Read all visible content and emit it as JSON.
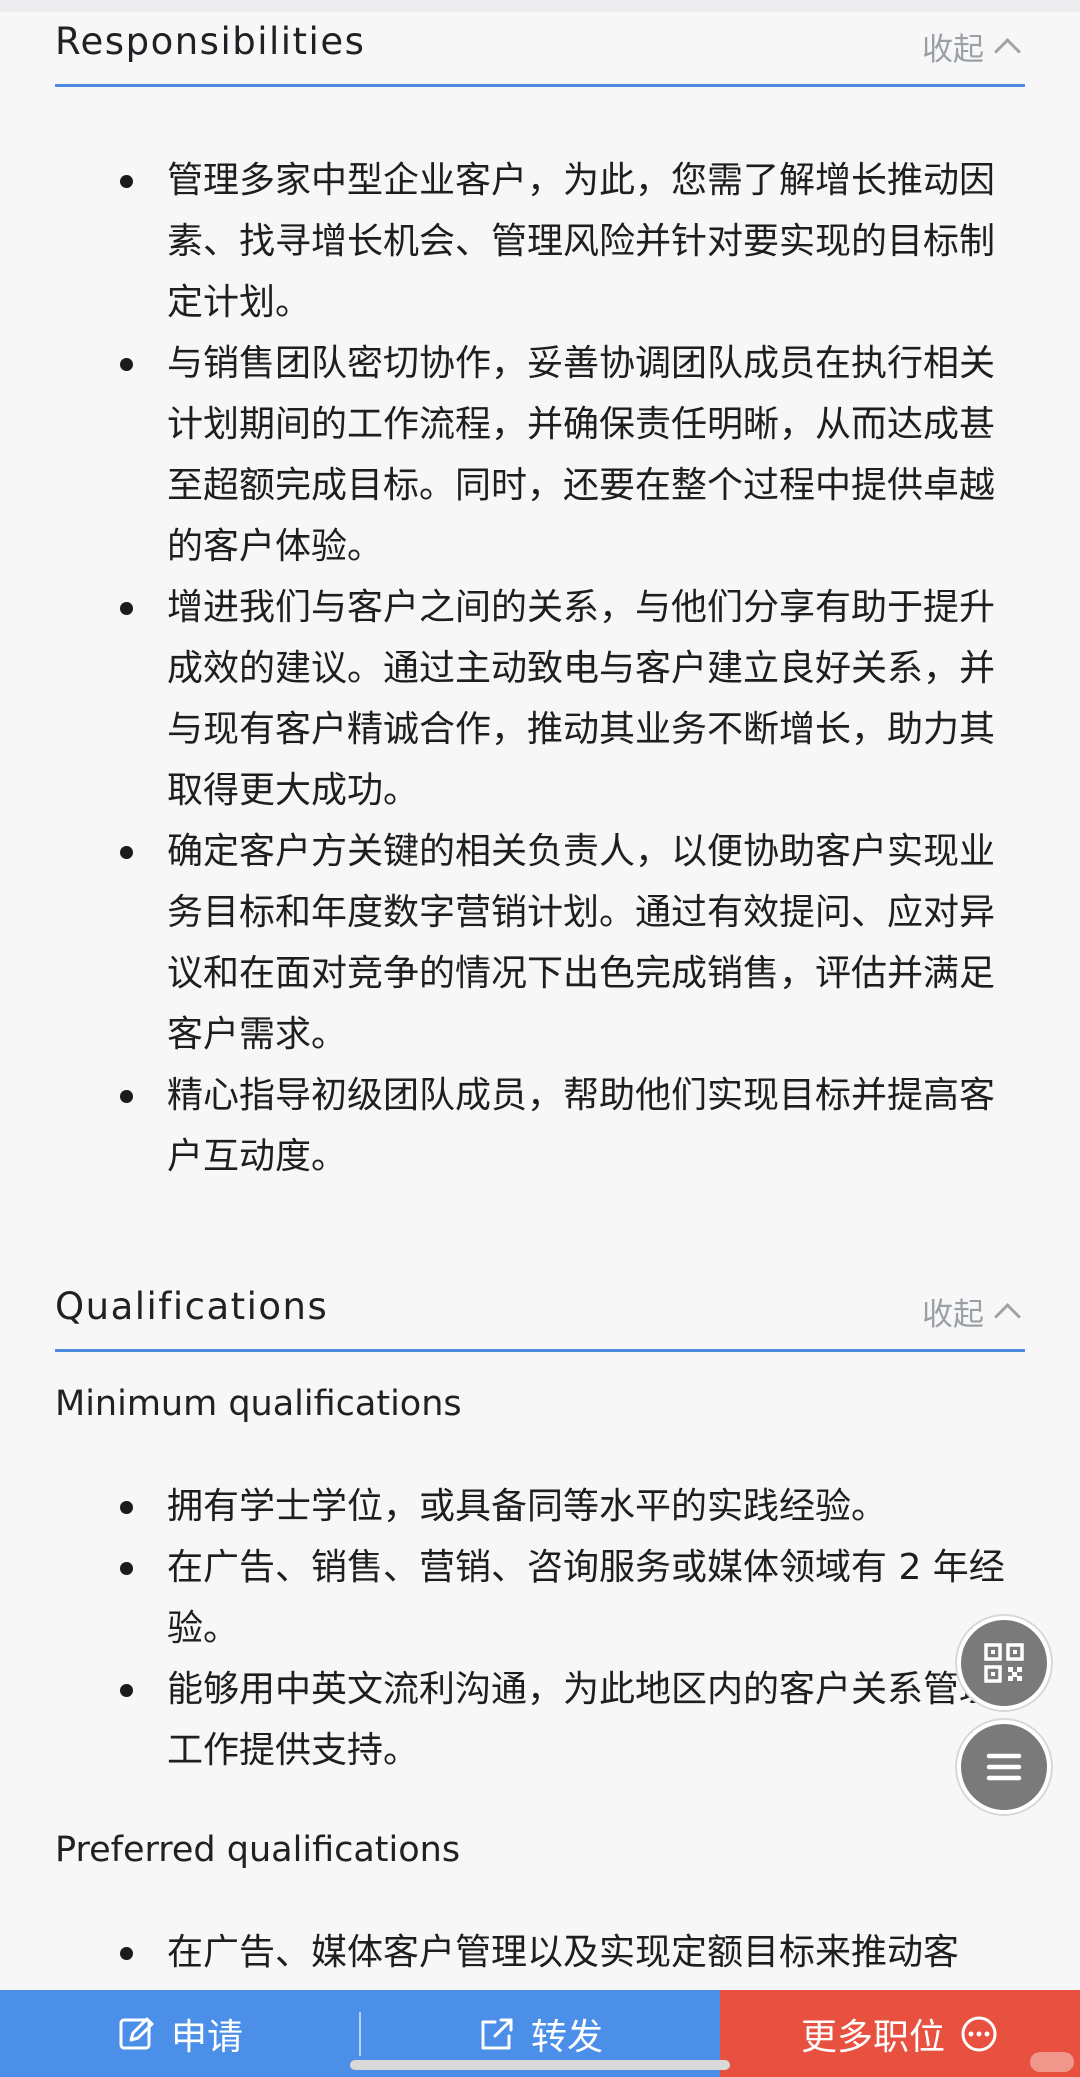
{
  "responsibilities": {
    "title": "Responsibilities",
    "collapse_label": "收起",
    "items": [
      "管理多家中型企业客户，为此，您需了解增长推动因素、找寻增长机会、管理风险并针对要实现的目标制定计划。",
      "与销售团队密切协作，妥善协调团队成员在执行相关计划期间的工作流程，并确保责任明晰，从而达成甚至超额完成目标。同时，还要在整个过程中提供卓越的客户体验。",
      "增进我们与客户之间的关系，与他们分享有助于提升成效的建议。通过主动致电与客户建立良好关系，并与现有客户精诚合作，推动其业务不断增长，助力其取得更大成功。",
      "确定客户方关键的相关负责人，以便协助客户实现业务目标和年度数字营销计划。通过有效提问、应对异议和在面对竞争的情况下出色完成销售，评估并满足客户需求。",
      "精心指导初级团队成员，帮助他们实现目标并提高客户互动度。"
    ]
  },
  "qualifications": {
    "title": "Qualifications",
    "collapse_label": "收起",
    "minimum_heading": "Minimum qualifications",
    "minimum_items": [
      "拥有学士学位，或具备同等水平的实践经验。",
      "在广告、销售、营销、咨询服务或媒体领域有 2 年经验。",
      "能够用中英文流利沟通，为此地区内的客户关系管理工作提供支持。"
    ],
    "preferred_heading": "Preferred qualifications",
    "preferred_items": [
      "在广告、媒体客户管理以及实现定额目标来推动客"
    ]
  },
  "floating_buttons": {
    "qr_icon": "qr-code-icon",
    "menu_icon": "menu-icon"
  },
  "bottom_bar": {
    "apply_label": "申请",
    "share_label": "转发",
    "more_label": "更多职位",
    "apply_color": "#4b8fe9",
    "more_color": "#e8513f"
  }
}
